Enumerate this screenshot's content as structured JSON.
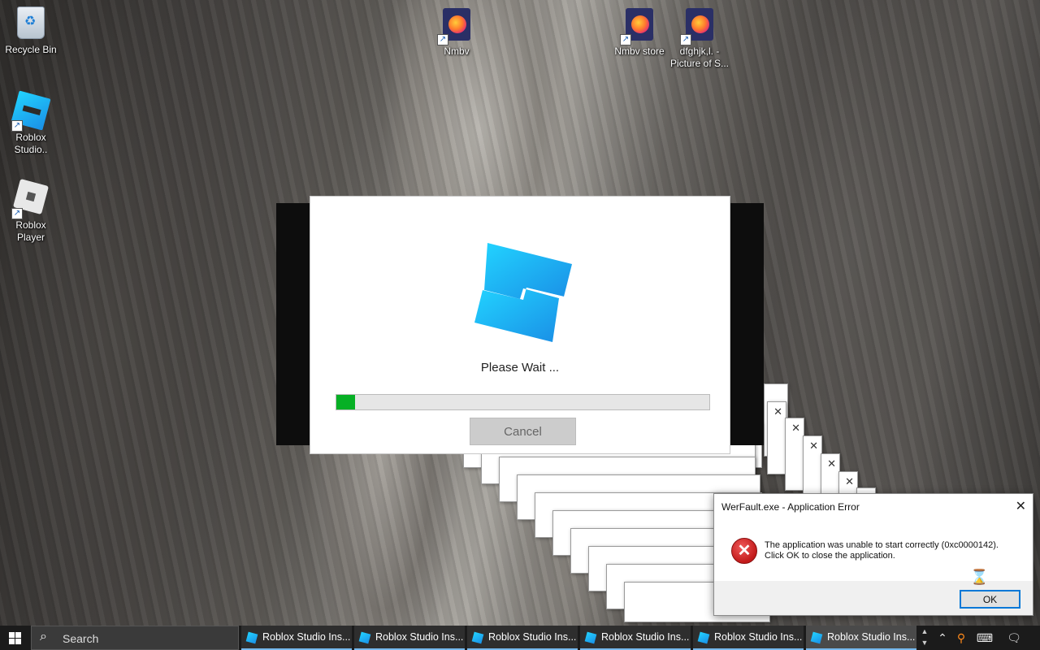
{
  "desktop": {
    "icons": [
      {
        "label": "Recycle Bin",
        "icon": "recycle-bin-icon"
      },
      {
        "label": "Roblox Studio..",
        "icon": "roblox-studio-icon"
      },
      {
        "label": "Roblox Player",
        "icon": "roblox-player-icon"
      },
      {
        "label": "Nmbv",
        "icon": "firefox-icon"
      },
      {
        "label": "Nmbv store",
        "icon": "firefox-icon"
      },
      {
        "label": "dfghjk,l. - Picture of S...",
        "icon": "firefox-icon"
      }
    ]
  },
  "background_dialogs": {
    "ok_label": "OK",
    "close_glyph": "✕"
  },
  "installer": {
    "logo": "roblox-studio-logo",
    "status": "Please Wait ...",
    "progress": 0.05,
    "cancel_label": "Cancel",
    "colors": {
      "progress": "#06b025",
      "logo_top": "#22d3ff",
      "logo_bottom": "#1a8fe6"
    }
  },
  "werfault": {
    "title": "WerFault.exe - Application Error",
    "message_line1": "The application was unable to start correctly (0xc0000142).",
    "message_line2": "Click OK to close the application.",
    "ok_label": "OK",
    "close_glyph": "✕",
    "icon": "error-x-icon"
  },
  "taskbar": {
    "search_label": "Search",
    "tasks": [
      {
        "label": "Roblox Studio Ins..."
      },
      {
        "label": "Roblox Studio Ins..."
      },
      {
        "label": "Roblox Studio Ins..."
      },
      {
        "label": "Roblox Studio Ins..."
      },
      {
        "label": "Roblox Studio Ins..."
      },
      {
        "label": "Roblox Studio Ins..."
      }
    ],
    "active_task_index": 5,
    "tray": [
      "chevron-up-icon",
      "search-tray-icon",
      "keyboard-icon",
      "notification-icon"
    ]
  }
}
